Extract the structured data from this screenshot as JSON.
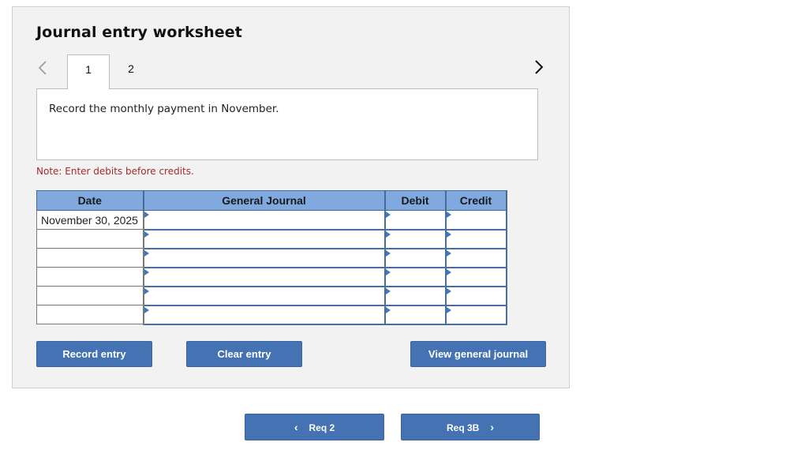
{
  "worksheet": {
    "title": "Journal entry worksheet",
    "nav_prev_icon": "‹",
    "nav_next_icon": "›",
    "tabs": [
      {
        "label": "1",
        "active": true
      },
      {
        "label": "2",
        "active": false
      }
    ],
    "prompt": "Record the monthly payment in November.",
    "note": "Note: Enter debits before credits.",
    "colors": {
      "panel_bg": "#f2f2f2",
      "header_bg": "#7fa9df",
      "button_bg": "#4472b2",
      "note_text": "#a52a2a"
    }
  },
  "table": {
    "headers": {
      "date": "Date",
      "account": "General Journal",
      "debit": "Debit",
      "credit": "Credit"
    },
    "rows": [
      {
        "date": "November 30, 2025",
        "account": "",
        "debit": "",
        "credit": ""
      },
      {
        "date": "",
        "account": "",
        "debit": "",
        "credit": ""
      },
      {
        "date": "",
        "account": "",
        "debit": "",
        "credit": ""
      },
      {
        "date": "",
        "account": "",
        "debit": "",
        "credit": ""
      },
      {
        "date": "",
        "account": "",
        "debit": "",
        "credit": ""
      },
      {
        "date": "",
        "account": "",
        "debit": "",
        "credit": ""
      }
    ]
  },
  "buttons": {
    "record": "Record entry",
    "clear": "Clear entry",
    "view": "View general journal"
  },
  "footer_nav": {
    "prev_label": "Req 2",
    "prev_icon": "‹",
    "next_label": "Req 3B",
    "next_icon": "›"
  }
}
